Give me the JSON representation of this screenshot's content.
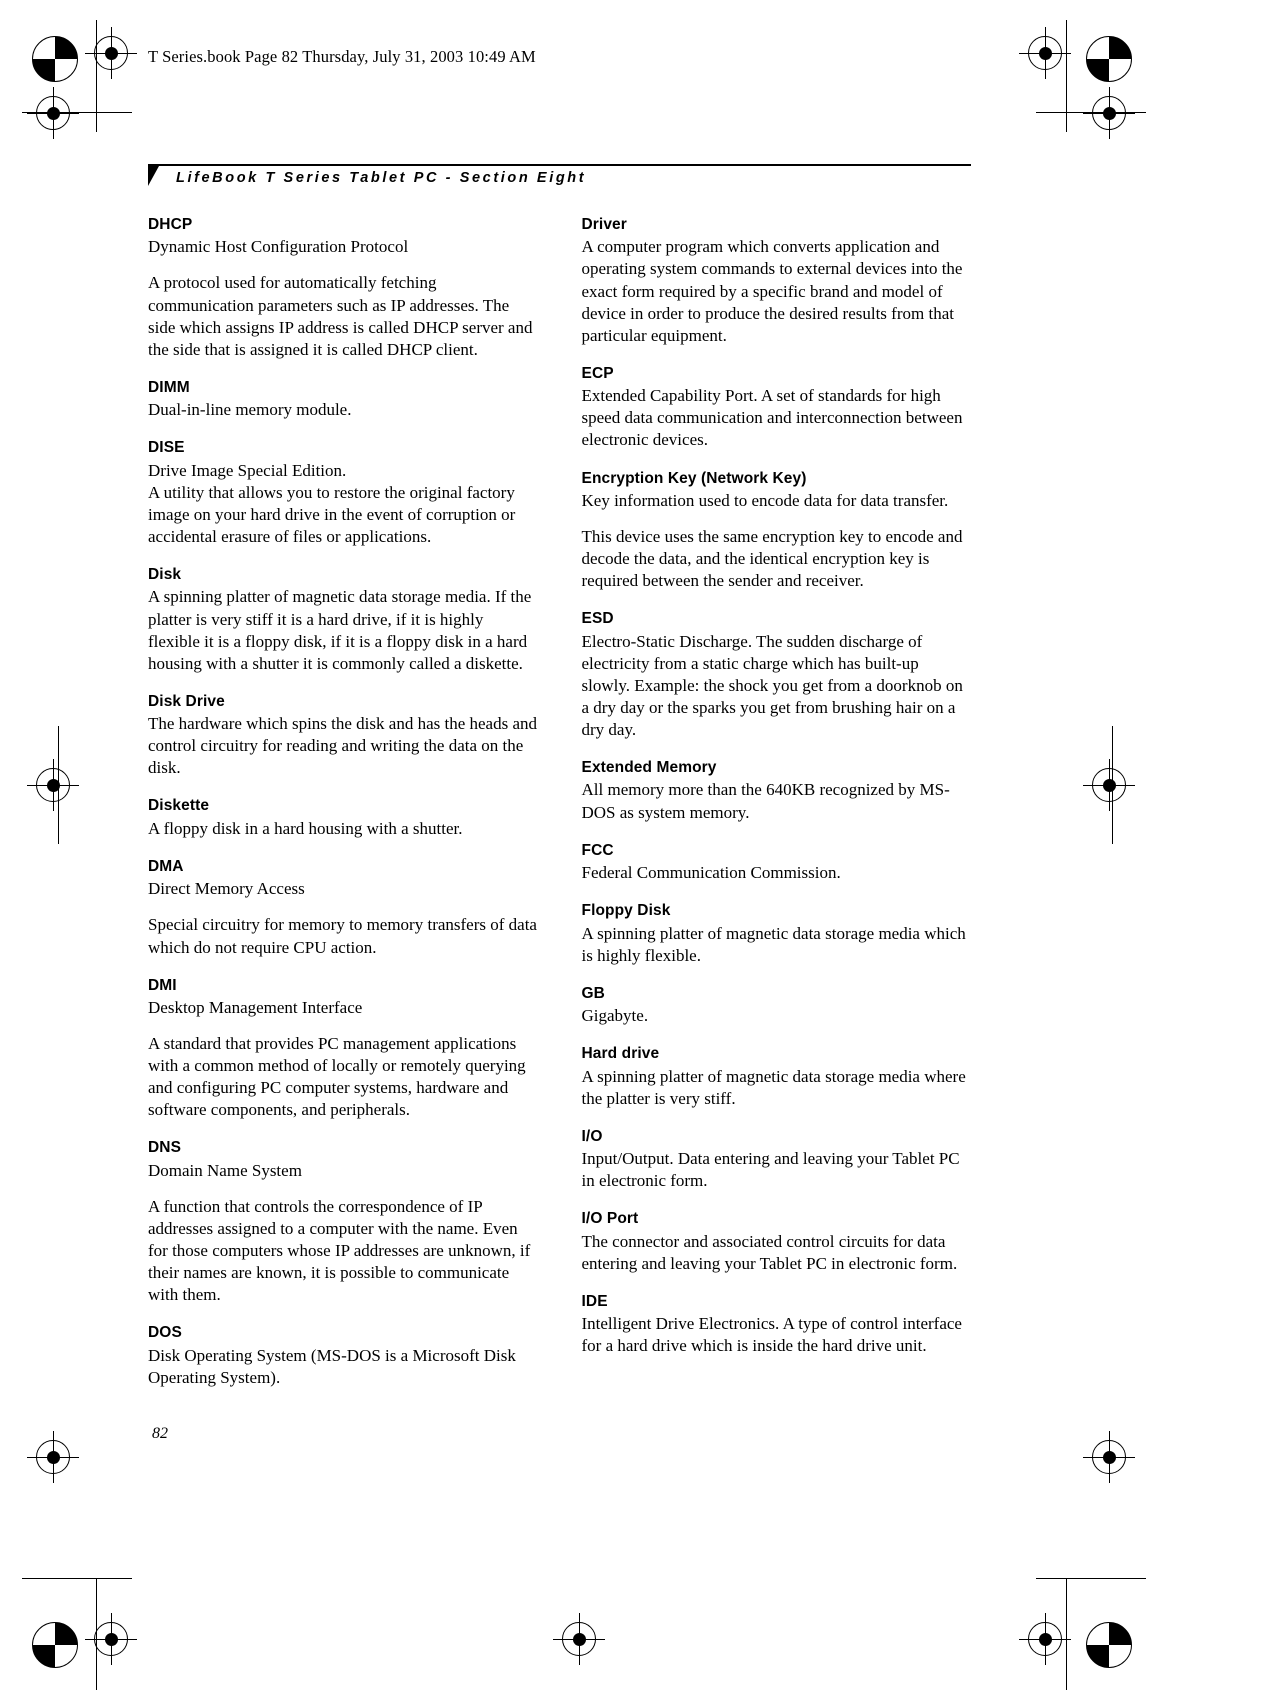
{
  "file_banner": "T Series.book  Page 82  Thursday, July 31, 2003  10:49 AM",
  "header": {
    "title": "LifeBook T Series Tablet PC - Section Eight"
  },
  "page_number": "82",
  "columns": [
    {
      "entries": [
        {
          "term": "DHCP",
          "paragraphs": [
            "Dynamic Host Configuration Protocol",
            "A protocol used for automatically fetching communication parameters such as IP addresses. The side which assigns IP address is called DHCP server and the side that is assigned it is called DHCP client."
          ]
        },
        {
          "term": "DIMM",
          "paragraphs": [
            "Dual-in-line memory module."
          ]
        },
        {
          "term": "DISE",
          "paragraphs": [
            "Drive Image Special Edition.\nA utility that allows you to restore the original factory image on your hard drive in the event of corruption or accidental erasure of files or applications."
          ]
        },
        {
          "term": "Disk",
          "paragraphs": [
            "A spinning platter of magnetic data storage media. If the platter is very stiff it is a hard drive, if it is highly flexible it is a floppy disk, if it is a floppy disk in a hard housing with a shutter it is commonly called a diskette."
          ]
        },
        {
          "term": "Disk Drive",
          "paragraphs": [
            "The hardware which spins the disk and has the heads and control circuitry for reading and writing the data on the disk."
          ]
        },
        {
          "term": "Diskette",
          "paragraphs": [
            "A floppy disk in a hard housing with a shutter."
          ]
        },
        {
          "term": "DMA",
          "paragraphs": [
            "Direct Memory Access",
            "Special circuitry for memory to memory transfers of data which do not require CPU action."
          ]
        },
        {
          "term": "DMI",
          "paragraphs": [
            "Desktop Management Interface",
            "A standard that provides PC management applications with a common method of locally or remotely querying and configuring PC computer systems, hardware and software components, and peripherals."
          ]
        },
        {
          "term": "DNS",
          "paragraphs": [
            "Domain Name System",
            "A function that controls the correspondence of IP addresses assigned to a computer with the name. Even for those computers whose IP addresses are unknown, if their names are known, it is possible to communicate with them."
          ]
        },
        {
          "term": "DOS",
          "paragraphs": [
            "Disk Operating System (MS-DOS is a Microsoft Disk Operating System)."
          ]
        }
      ]
    },
    {
      "entries": [
        {
          "term": "Driver",
          "paragraphs": [
            "A computer program which converts application and operating system commands to external devices into the exact form required by a specific brand and model of device in order to produce the desired results from that particular equipment."
          ]
        },
        {
          "term": "ECP",
          "paragraphs": [
            "Extended Capability Port. A set of standards for high speed data communication and interconnection between electronic devices."
          ]
        },
        {
          "term": "Encryption Key (Network Key)",
          "paragraphs": [
            "Key information used to encode data for data transfer.",
            "This device uses the same encryption key to encode and decode the data, and the identical encryption key is required between the sender and receiver."
          ]
        },
        {
          "term": "ESD",
          "paragraphs": [
            "Electro-Static Discharge. The sudden discharge of electricity from a static charge which has built-up slowly. Example: the shock you get from a doorknob on a dry day or the sparks you get from brushing hair on a dry day."
          ]
        },
        {
          "term": "Extended Memory",
          "paragraphs": [
            "All memory more than the 640KB recognized by MS-DOS as system memory."
          ]
        },
        {
          "term": "FCC",
          "paragraphs": [
            "Federal Communication Commission."
          ]
        },
        {
          "term": "Floppy Disk",
          "paragraphs": [
            "A spinning platter of magnetic data storage media which is highly flexible."
          ]
        },
        {
          "term": "GB",
          "paragraphs": [
            "Gigabyte."
          ]
        },
        {
          "term": "Hard drive",
          "paragraphs": [
            "A spinning platter of magnetic data storage media where the platter is very stiff."
          ]
        },
        {
          "term": "I/O",
          "paragraphs": [
            "Input/Output. Data entering and leaving your Tablet PC in electronic form."
          ]
        },
        {
          "term": "I/O Port",
          "paragraphs": [
            "The connector and associated control circuits for data entering and leaving your Tablet PC in electronic form."
          ]
        },
        {
          "term": "IDE",
          "paragraphs": [
            "Intelligent Drive Electronics. A type of control interface for a hard drive which is inside the hard drive unit."
          ]
        }
      ]
    }
  ]
}
